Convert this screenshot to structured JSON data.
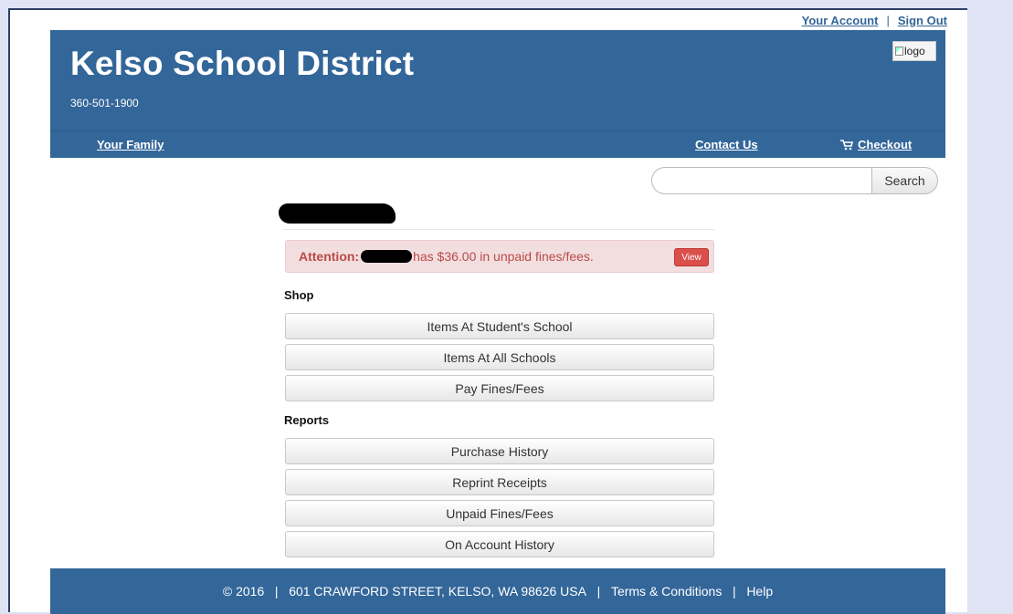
{
  "topbar": {
    "account": "Your Account",
    "separator": "|",
    "signout": "Sign Out"
  },
  "header": {
    "title": "Kelso School District",
    "phone": "360-501-1900",
    "logo_alt": "logo"
  },
  "nav": {
    "family": "Your Family",
    "contact": "Contact Us",
    "checkout": "Checkout"
  },
  "search": {
    "button": "Search",
    "value": ""
  },
  "alert": {
    "lead": "Attention:",
    "message": "has $36.00 in unpaid fines/fees.",
    "view": "View"
  },
  "shop": {
    "title": "Shop",
    "items": [
      "Items At Student's School",
      "Items At All Schools",
      "Pay Fines/Fees"
    ]
  },
  "reports": {
    "title": "Reports",
    "items": [
      "Purchase History",
      "Reprint Receipts",
      "Unpaid Fines/Fees",
      "On Account History"
    ]
  },
  "footer": {
    "copyright": "© 2016",
    "sep": "|",
    "address": "601 CRAWFORD STREET, KELSO, WA 98626 USA",
    "terms": "Terms & Conditions",
    "help": "Help"
  },
  "colors": {
    "brand": "#336699",
    "alert_bg": "#f2dede",
    "alert_text": "#b94a48",
    "view_button": "#da4f49"
  }
}
